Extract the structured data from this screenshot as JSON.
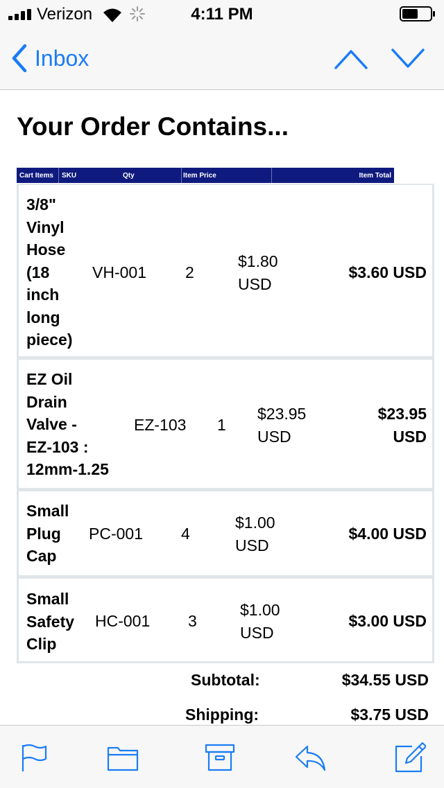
{
  "status_bar": {
    "carrier": "Verizon",
    "time": "4:11 PM"
  },
  "nav": {
    "back_label": "Inbox"
  },
  "email": {
    "heading": "Your Order Contains...",
    "table_headers": [
      "Cart Items",
      "SKU",
      "Qty",
      "Item Price",
      "Item Total"
    ],
    "items": [
      {
        "name_lines": [
          "3/8\"",
          "Vinyl",
          "Hose",
          "(18",
          "inch",
          "long",
          "piece)"
        ],
        "sku": "VH-001",
        "qty": "2",
        "price_lines": [
          "$1.80",
          "USD"
        ],
        "total_lines": [
          "$3.60 USD"
        ]
      },
      {
        "name_lines": [
          "EZ Oil",
          "Drain",
          "Valve -",
          "EZ-103 :",
          "12mm-1.25"
        ],
        "sku": "EZ-103",
        "qty": "1",
        "price_lines": [
          "$23.95",
          "USD"
        ],
        "total_lines": [
          "$23.95",
          "USD"
        ]
      },
      {
        "name_lines": [
          "Small",
          "Plug",
          "Cap"
        ],
        "sku": "PC-001",
        "qty": "4",
        "price_lines": [
          "$1.00",
          "USD"
        ],
        "total_lines": [
          "$4.00 USD"
        ]
      },
      {
        "name_lines": [
          "Small",
          "Safety",
          "Clip"
        ],
        "sku": "HC-001",
        "qty": "3",
        "price_lines": [
          "$1.00",
          "USD"
        ],
        "total_lines": [
          "$3.00 USD"
        ]
      }
    ],
    "summary": {
      "subtotal_label": "Subtotal:",
      "subtotal_value": "$34.55 USD",
      "shipping_label": "Shipping:",
      "shipping_value": "$3.75 USD"
    }
  },
  "toolbar": {
    "icons": [
      "flag-icon",
      "folder-icon",
      "archive-icon",
      "reply-icon",
      "compose-icon"
    ]
  },
  "colors": {
    "ios_blue": "#1a7cf5",
    "table_header_bg": "#0f1a7e",
    "row_border": "#dfe5e8"
  }
}
